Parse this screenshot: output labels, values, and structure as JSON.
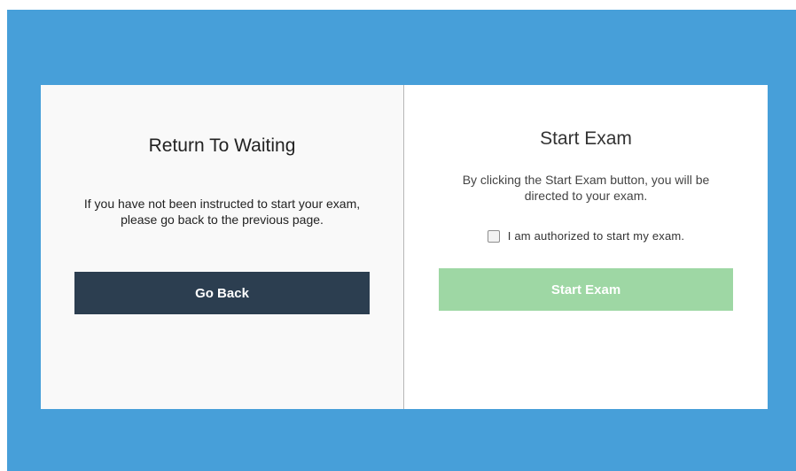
{
  "left_panel": {
    "title": "Return To Waiting",
    "description": "If you have not been instructed to start your exam, please go back to the previous page.",
    "button_label": "Go Back"
  },
  "right_panel": {
    "title": "Start Exam",
    "description": "By clicking the Start Exam button, you will be directed to your exam.",
    "checkbox_label": "I am authorized to start my exam.",
    "checkbox_checked": false,
    "button_label": "Start Exam",
    "button_enabled": false
  },
  "colors": {
    "background": "#479fd9",
    "go_back_button": "#2c3e50",
    "start_exam_button_disabled": "#9ed7a4"
  }
}
